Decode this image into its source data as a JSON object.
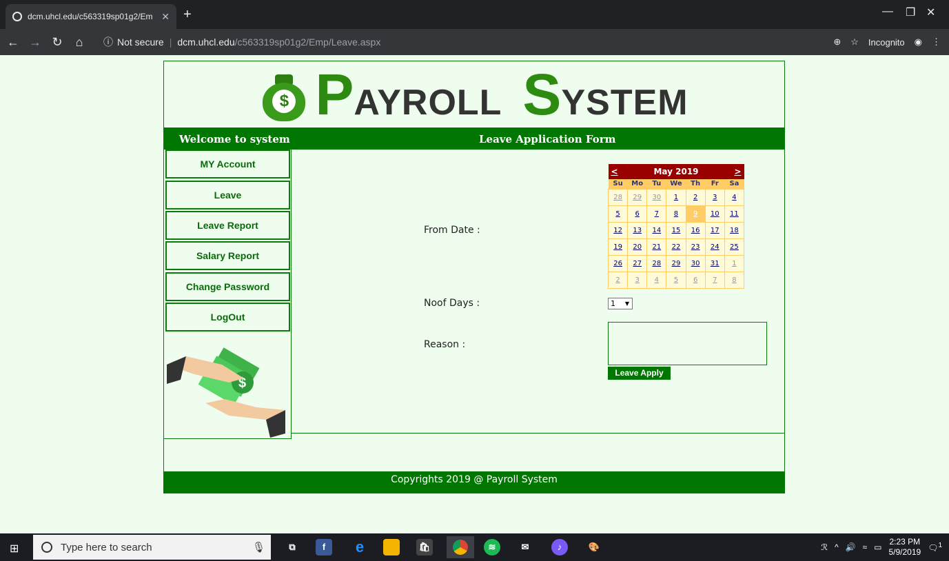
{
  "browser": {
    "tab_title": "dcm.uhcl.edu/c563319sp01g2/Em",
    "url_security": "Not secure",
    "url_host": "dcm.uhcl.edu",
    "url_path": "/c563319sp01g2/Emp/Leave.aspx",
    "incognito_label": "Incognito"
  },
  "banner": {
    "p_big": "P",
    "p_rest": "AYROLL",
    "s_big": "S",
    "s_rest": "YSTEM"
  },
  "header": {
    "welcome": "Welcome to system",
    "form_title": "Leave Application Form"
  },
  "sidebar": {
    "items": [
      {
        "label": "MY Account"
      },
      {
        "label": "Leave"
      },
      {
        "label": "Leave Report"
      },
      {
        "label": "Salary Report"
      },
      {
        "label": "Change Password"
      },
      {
        "label": "LogOut"
      }
    ]
  },
  "form": {
    "from_date_label": "From Date :",
    "noof_days_label": "Noof Days :",
    "noof_days_value": "1",
    "reason_label": "Reason :",
    "reason_value": "",
    "apply_label": "Leave Apply"
  },
  "calendar": {
    "prev": "<",
    "next": ">",
    "month": "May 2019",
    "dow": [
      "Su",
      "Mo",
      "Tu",
      "We",
      "Th",
      "Fr",
      "Sa"
    ],
    "weeks": [
      [
        {
          "d": "28",
          "o": true
        },
        {
          "d": "29",
          "o": true
        },
        {
          "d": "30",
          "o": true
        },
        {
          "d": "1"
        },
        {
          "d": "2"
        },
        {
          "d": "3"
        },
        {
          "d": "4"
        }
      ],
      [
        {
          "d": "5"
        },
        {
          "d": "6"
        },
        {
          "d": "7"
        },
        {
          "d": "8"
        },
        {
          "d": "9",
          "sel": true
        },
        {
          "d": "10"
        },
        {
          "d": "11"
        }
      ],
      [
        {
          "d": "12"
        },
        {
          "d": "13"
        },
        {
          "d": "14"
        },
        {
          "d": "15"
        },
        {
          "d": "16"
        },
        {
          "d": "17"
        },
        {
          "d": "18"
        }
      ],
      [
        {
          "d": "19"
        },
        {
          "d": "20"
        },
        {
          "d": "21"
        },
        {
          "d": "22"
        },
        {
          "d": "23"
        },
        {
          "d": "24"
        },
        {
          "d": "25"
        }
      ],
      [
        {
          "d": "26"
        },
        {
          "d": "27"
        },
        {
          "d": "28"
        },
        {
          "d": "29"
        },
        {
          "d": "30"
        },
        {
          "d": "31"
        },
        {
          "d": "1",
          "o": true
        }
      ],
      [
        {
          "d": "2",
          "o": true
        },
        {
          "d": "3",
          "o": true
        },
        {
          "d": "4",
          "o": true
        },
        {
          "d": "5",
          "o": true
        },
        {
          "d": "6",
          "o": true
        },
        {
          "d": "7",
          "o": true
        },
        {
          "d": "8",
          "o": true
        }
      ]
    ]
  },
  "footer": {
    "text": "Copyrights 2019 @ Payroll System"
  },
  "taskbar": {
    "search_placeholder": "Type here to search",
    "time": "2:23 PM",
    "date": "5/9/2019",
    "notification_count": "1"
  },
  "colors": {
    "theme_green": "#007700",
    "page_bg": "#eefdee",
    "calendar_header": "#990000",
    "calendar_accent": "#ffcc66"
  }
}
